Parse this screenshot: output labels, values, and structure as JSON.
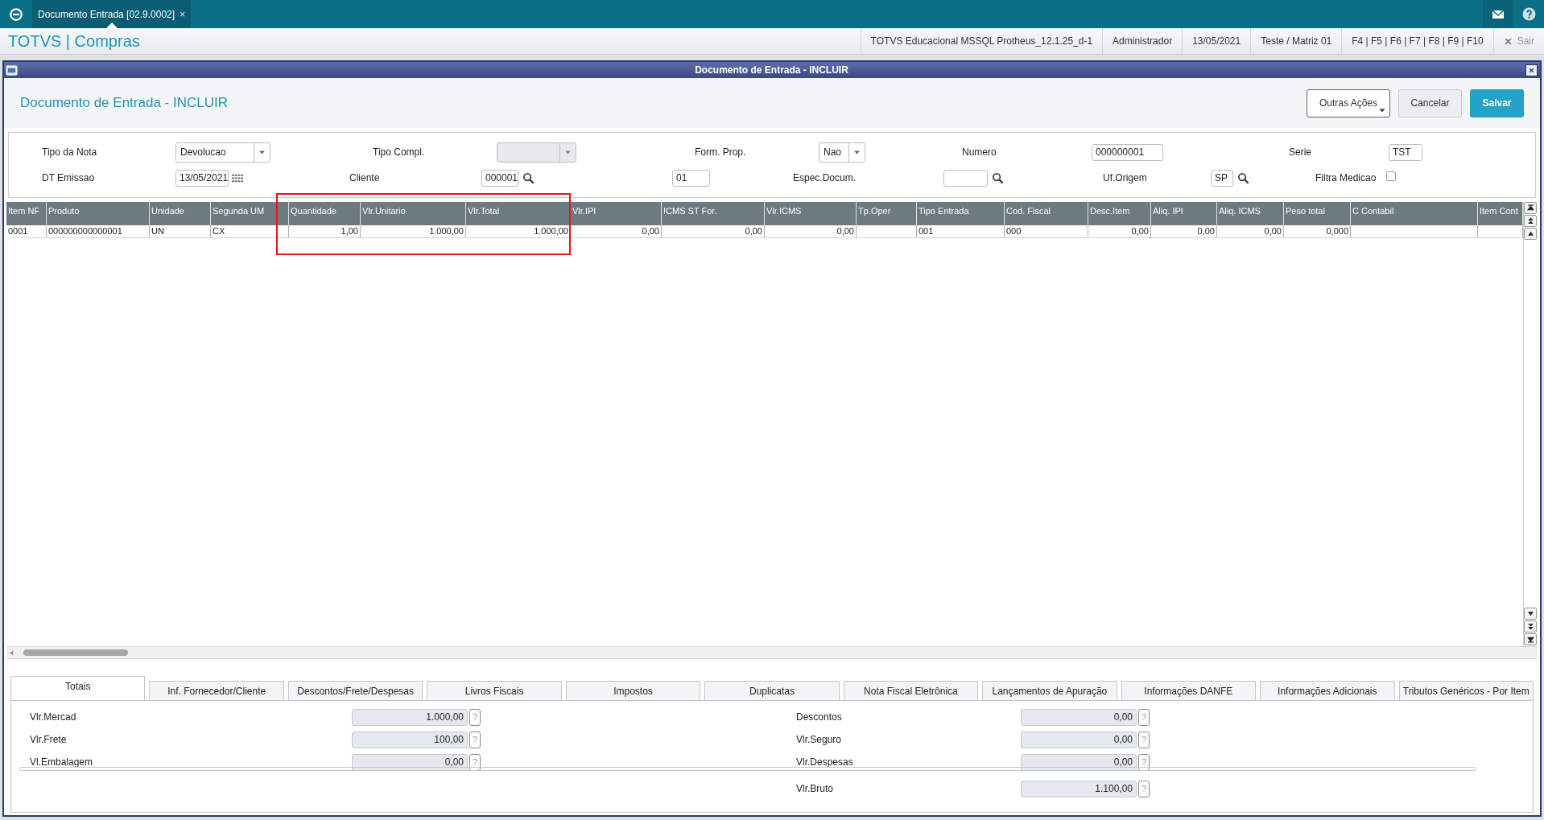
{
  "top_bar": {
    "tab": {
      "label": "Documento Entrada [02.9.0002]",
      "close": "×",
      "selected": true
    }
  },
  "app_bar": {
    "title": "TOTVS | Compras",
    "info": [
      "TOTVS Educacional MSSQL Protheus_12.1.25_d-1",
      "Administrador",
      "13/05/2021",
      "Teste / Matriz 01",
      "F4 | F5 | F6 | F7 | F8 | F9 | F10"
    ],
    "exit": "Sair"
  },
  "window": {
    "title": "Documento de Entrada - INCLUIR",
    "heading": "Documento de Entrada - INCLUIR",
    "buttons": [
      {
        "label": "Outras Ações",
        "kind": "menu"
      },
      {
        "label": "Cancelar",
        "kind": "secondary"
      },
      {
        "label": "Salvar",
        "kind": "primary"
      }
    ]
  },
  "form": {
    "rows": [
      [
        {
          "kind": "label",
          "text": "Tipo da Nota"
        },
        {
          "kind": "select",
          "value": "Devolucao",
          "disabled": false
        },
        {
          "kind": "label",
          "text": "Tipo Compl."
        },
        {
          "kind": "select",
          "disabled": true
        },
        {
          "kind": "label",
          "text": "Form. Prop."
        },
        {
          "kind": "select",
          "value": "Nao",
          "disabled": false
        },
        {
          "kind": "label",
          "text": "Numero"
        },
        {
          "kind": "input",
          "value": "000000001"
        },
        {
          "kind": "label",
          "text": "Serie"
        },
        {
          "kind": "input",
          "value": "TST"
        }
      ],
      [
        {
          "kind": "label",
          "text": "DT Emissao"
        },
        {
          "kind": "date",
          "value": "13/05/2021"
        },
        {
          "kind": "label",
          "text": "Cliente"
        },
        {
          "kind": "lookup",
          "value": "000001"
        },
        {
          "kind": "input",
          "value": "01"
        },
        {
          "kind": "label",
          "text": "Espec.Docum."
        },
        {
          "kind": "lookup"
        },
        {
          "kind": "label",
          "text": "Uf.Origem"
        },
        {
          "kind": "lookup",
          "value": "SP"
        },
        {
          "kind": "label",
          "text": "Filtra Medicao"
        },
        {
          "kind": "checkbox",
          "checked": false
        }
      ]
    ]
  },
  "table": {
    "columns": [
      "Item NF",
      "Produto",
      "Unidade",
      "Segunda UM",
      "Quantidade",
      "Vlr.Unitario",
      "Vlr.Total",
      "Vlr.IPI",
      "ICMS ST For.",
      "Vlr.ICMS",
      "Tp.Oper",
      "Tipo Entrada",
      "Cod. Fiscal",
      "Desc.Item",
      "Aliq. IPI",
      "Aliq. ICMS",
      "Peso total",
      "C Contabil",
      "Item Cont"
    ],
    "rows": [
      [
        "0001",
        "000000000000001",
        "UN",
        "CX",
        "1,00",
        "1.000,00",
        "1.000,00",
        "0,00",
        "0,00",
        "0,00",
        null,
        "001",
        "000",
        "0,00",
        "0,00",
        "0,00",
        "0,000",
        null,
        null
      ]
    ]
  },
  "tabs": [
    {
      "label": "Totais",
      "selected": true
    },
    {
      "label": "Inf. Fornecedor/Cliente",
      "selected": false
    },
    {
      "label": "Descontos/Frete/Despesas",
      "selected": false
    },
    {
      "label": "Livros Fiscais",
      "selected": false
    },
    {
      "label": "Impostos",
      "selected": false
    },
    {
      "label": "Duplicatas",
      "selected": false
    },
    {
      "label": "Nota Fiscal Eletrônica",
      "selected": false
    },
    {
      "label": "Lançamentos de Apuração",
      "selected": false
    },
    {
      "label": "Informações DANFE",
      "selected": false
    },
    {
      "label": "Informações Adicionais",
      "selected": false
    },
    {
      "label": "Tributos Genéricos - Por Item",
      "selected": false
    }
  ],
  "totals": {
    "left": [
      {
        "label": "Vlr.Mercad",
        "value": "1.000,00"
      },
      {
        "label": "Vlr.Frete",
        "value": "100,00"
      },
      {
        "label": "Vl.Embalagem",
        "value": "0,00"
      }
    ],
    "right": [
      {
        "label": "Descontos",
        "value": "0,00"
      },
      {
        "label": "Vlr.Seguro",
        "value": "0,00"
      },
      {
        "label": "Vlr.Despesas",
        "value": "0,00"
      }
    ],
    "total": {
      "label": "Vlr.Bruto",
      "value": "1.100,00"
    },
    "help": "?"
  }
}
